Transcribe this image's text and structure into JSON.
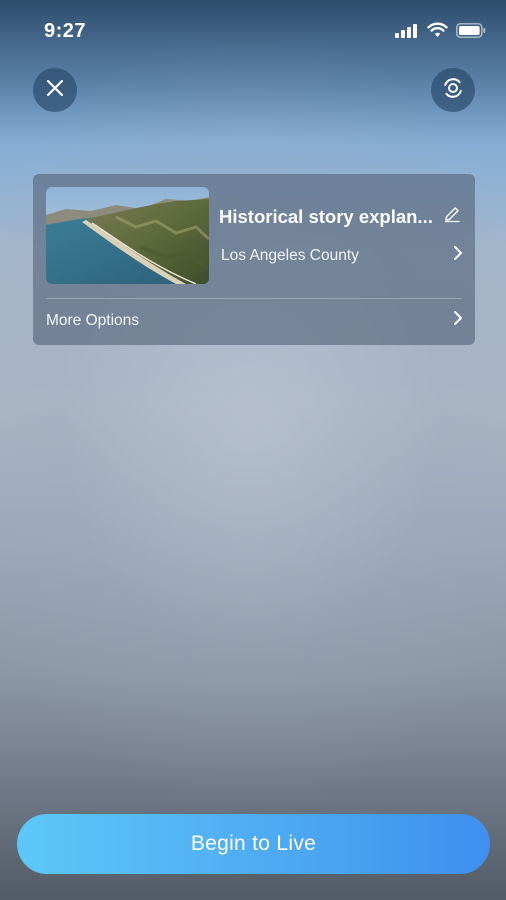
{
  "status_bar": {
    "time": "9:27",
    "icons": [
      "cellular-signal-icon",
      "wifi-icon",
      "battery-icon"
    ]
  },
  "top_controls": {
    "close_icon": "close-icon",
    "camera_icon": "camera-flip-icon"
  },
  "live_setup": {
    "thumbnail": "coastline-aerial-thumbnail",
    "title": "Historical story explan...",
    "edit_icon": "pencil-icon",
    "location": "Los Angeles County",
    "more_options": "More Options"
  },
  "cta": {
    "label": "Begin to Live"
  },
  "colors": {
    "button_gradient_start": "#5cc8f8",
    "button_gradient_end": "#3f8ff0",
    "card_background": "rgba(85,100,122,0.62)"
  }
}
